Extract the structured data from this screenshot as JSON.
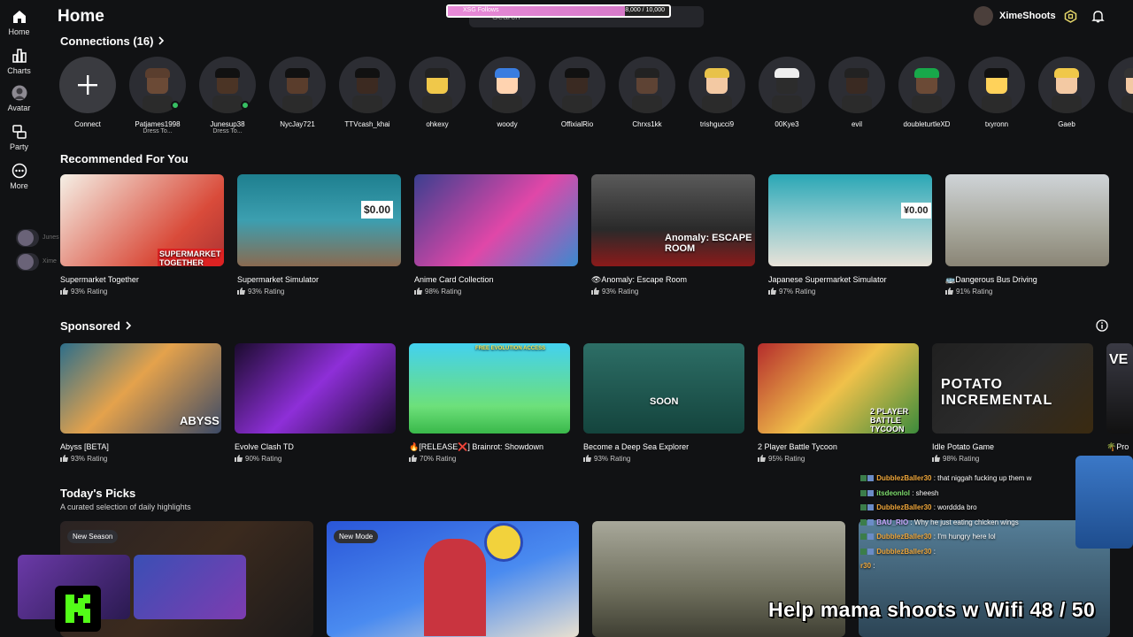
{
  "sidebar": {
    "items": [
      {
        "label": "Home",
        "icon": "home-icon"
      },
      {
        "label": "Charts",
        "icon": "charts-icon"
      },
      {
        "label": "Avatar",
        "icon": "avatar-icon"
      },
      {
        "label": "Party",
        "icon": "party-icon"
      },
      {
        "label": "More",
        "icon": "more-icon"
      }
    ],
    "friends": [
      {
        "label": "Junes"
      },
      {
        "label": "Xime"
      }
    ]
  },
  "header": {
    "title": "Home",
    "search_placeholder": "Search",
    "username": "XimeShoots",
    "goal": {
      "label": "XSG Follows",
      "current": "8,000",
      "target": "10,000",
      "progress": 0.8
    }
  },
  "connections": {
    "title": "Connections (16)",
    "items": [
      {
        "name": "Connect",
        "sub": ""
      },
      {
        "name": "Patjames1998",
        "sub": "Dress To...",
        "online": true
      },
      {
        "name": "Junesup38",
        "sub": "Dress To...",
        "online": true
      },
      {
        "name": "NycJay721",
        "sub": ""
      },
      {
        "name": "TTVcash_khai",
        "sub": ""
      },
      {
        "name": "ohkexy",
        "sub": ""
      },
      {
        "name": "woody",
        "sub": ""
      },
      {
        "name": "OffixialRio",
        "sub": ""
      },
      {
        "name": "Chrxs1kk",
        "sub": ""
      },
      {
        "name": "trishgucci9",
        "sub": ""
      },
      {
        "name": "00Kye3",
        "sub": ""
      },
      {
        "name": "evil",
        "sub": ""
      },
      {
        "name": "doubleturtleXD",
        "sub": ""
      },
      {
        "name": "txyronn",
        "sub": ""
      },
      {
        "name": "Gaeb",
        "sub": ""
      },
      {
        "name": "J",
        "sub": ""
      }
    ]
  },
  "recommended": {
    "title": "Recommended For You",
    "items": [
      {
        "title": "Supermarket Together",
        "rating": "93% Rating",
        "thumb_text": "SUPERMARKET TOGETHER"
      },
      {
        "title": "Supermarket Simulator",
        "rating": "93% Rating",
        "thumb_text": "$0.00"
      },
      {
        "title": "Anime Card Collection",
        "rating": "98% Rating",
        "thumb_text": ""
      },
      {
        "title": "👁Anomaly: Escape Room",
        "rating": "93% Rating",
        "thumb_text": "Anomaly: ESCAPE ROOM"
      },
      {
        "title": "Japanese Supermarket Simulator",
        "rating": "97% Rating",
        "thumb_text": "¥0.00"
      },
      {
        "title": "🚌Dangerous Bus Driving",
        "rating": "91% Rating",
        "thumb_text": ""
      }
    ]
  },
  "sponsored": {
    "title": "Sponsored",
    "items": [
      {
        "title": "Abyss [BETA]",
        "rating": "93% Rating",
        "thumb_text": "ABYSS"
      },
      {
        "title": "Evolve Clash TD",
        "rating": "90% Rating",
        "thumb_text": ""
      },
      {
        "title": "🔥[RELEASE❌] Brainrot: Showdown",
        "rating": "70% Rating",
        "thumb_text": "FREE EVOLUTION ACCESS"
      },
      {
        "title": "Become a Deep Sea Explorer",
        "rating": "93% Rating",
        "thumb_text": "SOON"
      },
      {
        "title": "2 Player Battle Tycoon",
        "rating": "95% Rating",
        "thumb_text": "2 PLAYER BATTLE TYCOON"
      },
      {
        "title": "Idle Potato Game",
        "rating": "98% Rating",
        "thumb_text": "POTATO INCREMENTAL"
      },
      {
        "title": "🌴Pro",
        "rating": "",
        "thumb_text": "VE"
      }
    ]
  },
  "picks": {
    "title": "Today's Picks",
    "subtitle": "A curated selection of daily highlights",
    "badges": [
      "New Season",
      "New Mode"
    ]
  },
  "chat": [
    {
      "user": "DubblezBaller30",
      "msg": " : that niggah fucking up them w",
      "color": "orange"
    },
    {
      "user": "itsdeonlol",
      "msg": " : sheesh",
      "color": "green"
    },
    {
      "user": "DubblezBaller30",
      "msg": " : worddda bro",
      "color": "orange"
    },
    {
      "user": "BAU_RIO",
      "msg": " : Why he just eating chicken wings",
      "color": "purple"
    },
    {
      "user": "DubblezBaller30",
      "msg": " : I'm hungry here lol",
      "color": "orange"
    },
    {
      "user": "DubblezBaller30",
      "msg": " :",
      "color": "orange"
    },
    {
      "user": "r30",
      "msg": " :",
      "color": "orange"
    }
  ],
  "stream_overlay": {
    "wifi_text": "Help mama shoots w Wifi  48 / 50"
  },
  "colors": {
    "background": "#111214",
    "online": "#37c063",
    "goal_fill": "#e88bd8"
  }
}
